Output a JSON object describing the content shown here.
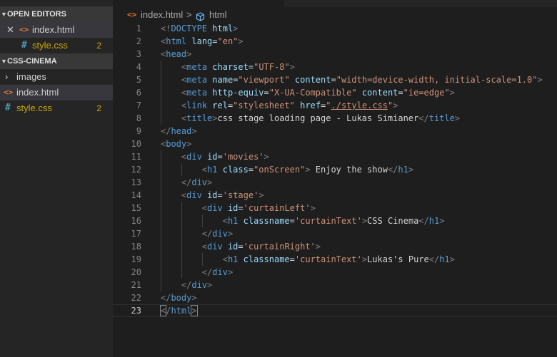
{
  "explorer": {
    "open_editors": {
      "header": "OPEN EDITORS",
      "items": [
        {
          "name": "index.html",
          "icon": "html-file-icon",
          "active": true
        },
        {
          "name": "style.css",
          "icon": "css-file-icon",
          "problems": "2"
        }
      ]
    },
    "project": {
      "header": "CSS-CINEMA",
      "items": [
        {
          "name": "images",
          "type": "folder"
        },
        {
          "name": "index.html",
          "icon": "html-file-icon",
          "selected": true
        },
        {
          "name": "style.css",
          "icon": "css-file-icon",
          "problems": "2"
        }
      ]
    }
  },
  "breadcrumb": {
    "file": "index.html",
    "separator": ">",
    "symbol": "html"
  },
  "editor": {
    "current_line": "23",
    "lines": [
      {
        "n": "1",
        "t": [
          [
            "t",
            "<!"
          ],
          [
            "n",
            "DOCTYPE"
          ],
          [
            "x",
            " "
          ],
          [
            "a",
            "html"
          ],
          [
            "t",
            ">"
          ]
        ]
      },
      {
        "n": "2",
        "t": [
          [
            "t",
            "<"
          ],
          [
            "n",
            "html"
          ],
          [
            "x",
            " "
          ],
          [
            "a",
            "lang"
          ],
          [
            "x",
            "="
          ],
          [
            "v",
            "\"en\""
          ],
          [
            "t",
            ">"
          ]
        ]
      },
      {
        "n": "3",
        "t": [
          [
            "t",
            "<"
          ],
          [
            "n",
            "head"
          ],
          [
            "t",
            ">"
          ]
        ]
      },
      {
        "n": "4",
        "t": [
          [
            "x",
            "    "
          ],
          [
            "t",
            "<"
          ],
          [
            "n",
            "meta"
          ],
          [
            "x",
            " "
          ],
          [
            "a",
            "charset"
          ],
          [
            "x",
            "="
          ],
          [
            "v",
            "\"UTF-8\""
          ],
          [
            "t",
            ">"
          ]
        ]
      },
      {
        "n": "5",
        "t": [
          [
            "x",
            "    "
          ],
          [
            "t",
            "<"
          ],
          [
            "n",
            "meta"
          ],
          [
            "x",
            " "
          ],
          [
            "a",
            "name"
          ],
          [
            "x",
            "="
          ],
          [
            "v",
            "\"viewport\""
          ],
          [
            "x",
            " "
          ],
          [
            "a",
            "content"
          ],
          [
            "x",
            "="
          ],
          [
            "v",
            "\"width=device-width, initial-scale=1.0\""
          ],
          [
            "t",
            ">"
          ]
        ]
      },
      {
        "n": "6",
        "t": [
          [
            "x",
            "    "
          ],
          [
            "t",
            "<"
          ],
          [
            "n",
            "meta"
          ],
          [
            "x",
            " "
          ],
          [
            "a",
            "http-equiv"
          ],
          [
            "x",
            "="
          ],
          [
            "v",
            "\"X-UA-Compatible\""
          ],
          [
            "x",
            " "
          ],
          [
            "a",
            "content"
          ],
          [
            "x",
            "="
          ],
          [
            "v",
            "\"ie=edge\""
          ],
          [
            "t",
            ">"
          ]
        ]
      },
      {
        "n": "7",
        "t": [
          [
            "x",
            "    "
          ],
          [
            "t",
            "<"
          ],
          [
            "n",
            "link"
          ],
          [
            "x",
            " "
          ],
          [
            "a",
            "rel"
          ],
          [
            "x",
            "="
          ],
          [
            "v",
            "\"stylesheet\""
          ],
          [
            "x",
            " "
          ],
          [
            "a",
            "href"
          ],
          [
            "x",
            "="
          ],
          [
            "v",
            "\""
          ],
          [
            "vu",
            "./style.css"
          ],
          [
            "v",
            "\""
          ],
          [
            "t",
            ">"
          ]
        ]
      },
      {
        "n": "8",
        "t": [
          [
            "x",
            "    "
          ],
          [
            "t",
            "<"
          ],
          [
            "n",
            "title"
          ],
          [
            "t",
            ">"
          ],
          [
            "x",
            "css stage loading page - Lukas Simianer"
          ],
          [
            "t",
            "</"
          ],
          [
            "n",
            "title"
          ],
          [
            "t",
            ">"
          ]
        ]
      },
      {
        "n": "9",
        "t": [
          [
            "t",
            "</"
          ],
          [
            "n",
            "head"
          ],
          [
            "t",
            ">"
          ]
        ]
      },
      {
        "n": "10",
        "t": [
          [
            "t",
            "<"
          ],
          [
            "n",
            "body"
          ],
          [
            "t",
            ">"
          ]
        ]
      },
      {
        "n": "11",
        "t": [
          [
            "x",
            "    "
          ],
          [
            "t",
            "<"
          ],
          [
            "n",
            "div"
          ],
          [
            "x",
            " "
          ],
          [
            "a",
            "id"
          ],
          [
            "x",
            "="
          ],
          [
            "v",
            "'movies'"
          ],
          [
            "t",
            ">"
          ]
        ]
      },
      {
        "n": "12",
        "t": [
          [
            "x",
            "        "
          ],
          [
            "t",
            "<"
          ],
          [
            "n",
            "h1"
          ],
          [
            "x",
            " "
          ],
          [
            "a",
            "class"
          ],
          [
            "x",
            "="
          ],
          [
            "v",
            "\"onScreen\""
          ],
          [
            "t",
            ">"
          ],
          [
            "x",
            " Enjoy the show"
          ],
          [
            "t",
            "</"
          ],
          [
            "n",
            "h1"
          ],
          [
            "t",
            ">"
          ]
        ]
      },
      {
        "n": "13",
        "t": [
          [
            "x",
            "    "
          ],
          [
            "t",
            "</"
          ],
          [
            "n",
            "div"
          ],
          [
            "t",
            ">"
          ]
        ]
      },
      {
        "n": "14",
        "t": [
          [
            "x",
            "    "
          ],
          [
            "t",
            "<"
          ],
          [
            "n",
            "div"
          ],
          [
            "x",
            " "
          ],
          [
            "a",
            "id"
          ],
          [
            "x",
            "="
          ],
          [
            "v",
            "'stage'"
          ],
          [
            "t",
            ">"
          ]
        ]
      },
      {
        "n": "15",
        "t": [
          [
            "x",
            "        "
          ],
          [
            "t",
            "<"
          ],
          [
            "n",
            "div"
          ],
          [
            "x",
            " "
          ],
          [
            "a",
            "id"
          ],
          [
            "x",
            "="
          ],
          [
            "v",
            "'curtainLeft'"
          ],
          [
            "t",
            ">"
          ]
        ]
      },
      {
        "n": "16",
        "t": [
          [
            "x",
            "            "
          ],
          [
            "t",
            "<"
          ],
          [
            "n",
            "h1"
          ],
          [
            "x",
            " "
          ],
          [
            "a",
            "classname"
          ],
          [
            "x",
            "="
          ],
          [
            "v",
            "'curtainText'"
          ],
          [
            "t",
            ">"
          ],
          [
            "x",
            "CSS Cinema"
          ],
          [
            "t",
            "</"
          ],
          [
            "n",
            "h1"
          ],
          [
            "t",
            ">"
          ]
        ]
      },
      {
        "n": "17",
        "t": [
          [
            "x",
            "        "
          ],
          [
            "t",
            "</"
          ],
          [
            "n",
            "div"
          ],
          [
            "t",
            ">"
          ]
        ]
      },
      {
        "n": "18",
        "t": [
          [
            "x",
            "        "
          ],
          [
            "t",
            "<"
          ],
          [
            "n",
            "div"
          ],
          [
            "x",
            " "
          ],
          [
            "a",
            "id"
          ],
          [
            "x",
            "="
          ],
          [
            "v",
            "'curtainRight'"
          ],
          [
            "t",
            ">"
          ]
        ]
      },
      {
        "n": "19",
        "t": [
          [
            "x",
            "            "
          ],
          [
            "t",
            "<"
          ],
          [
            "n",
            "h1"
          ],
          [
            "x",
            " "
          ],
          [
            "a",
            "classname"
          ],
          [
            "x",
            "="
          ],
          [
            "v",
            "'curtainText'"
          ],
          [
            "t",
            ">"
          ],
          [
            "x",
            "Lukas's Pure"
          ],
          [
            "t",
            "</"
          ],
          [
            "n",
            "h1"
          ],
          [
            "t",
            ">"
          ]
        ]
      },
      {
        "n": "20",
        "t": [
          [
            "x",
            "        "
          ],
          [
            "t",
            "</"
          ],
          [
            "n",
            "div"
          ],
          [
            "t",
            ">"
          ]
        ]
      },
      {
        "n": "21",
        "t": [
          [
            "x",
            "    "
          ],
          [
            "t",
            "</"
          ],
          [
            "n",
            "div"
          ],
          [
            "t",
            ">"
          ]
        ]
      },
      {
        "n": "22",
        "t": [
          [
            "t",
            "</"
          ],
          [
            "n",
            "body"
          ],
          [
            "t",
            ">"
          ]
        ]
      },
      {
        "n": "23",
        "t": [
          [
            "tb",
            "<"
          ],
          [
            "t",
            "/"
          ],
          [
            "n",
            "html"
          ],
          [
            "tb",
            ">"
          ],
          [
            "cursor",
            ""
          ]
        ]
      }
    ]
  },
  "colors": {
    "tag": "#569cd6",
    "attribute": "#9cdcfe",
    "string": "#ce9178",
    "punctuation": "#808080",
    "text": "#d4d4d4",
    "modified": "#cca700"
  }
}
